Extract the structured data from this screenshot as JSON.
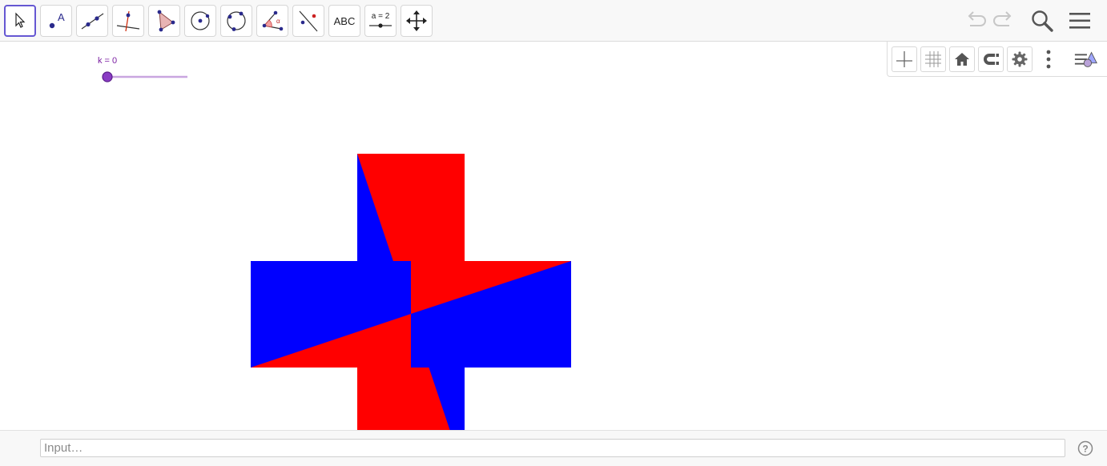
{
  "toolbar": {
    "tools": [
      {
        "name": "move-tool",
        "label": ""
      },
      {
        "name": "point-tool",
        "label": "A"
      },
      {
        "name": "line-tool",
        "label": ""
      },
      {
        "name": "perpendicular-line-tool",
        "label": ""
      },
      {
        "name": "polygon-tool",
        "label": ""
      },
      {
        "name": "circle-center-point-tool",
        "label": ""
      },
      {
        "name": "circle-three-points-tool",
        "label": ""
      },
      {
        "name": "angle-tool",
        "label": "α"
      },
      {
        "name": "reflect-tool",
        "label": ""
      },
      {
        "name": "text-tool",
        "label": "ABC"
      },
      {
        "name": "slider-tool",
        "label": "a = 2"
      },
      {
        "name": "move-graphics-view-tool",
        "label": ""
      }
    ],
    "selected_tool": "move-tool"
  },
  "slider": {
    "label": "k = 0",
    "value": 0,
    "color": "#7b1fa2"
  },
  "figure": {
    "colors": {
      "red": "#ff0000",
      "blue": "#0000ff"
    }
  },
  "input_bar": {
    "placeholder": "Input…",
    "value": ""
  },
  "icons": {
    "undo": "undo-icon",
    "redo": "redo-icon",
    "search": "search-icon",
    "menu": "menu-icon",
    "axes": "axes-icon",
    "grid": "grid-icon",
    "home": "home-icon",
    "point-capturing": "magnet-icon",
    "settings": "gear-icon",
    "more": "more-vertical-icon",
    "style-bar-toggle": "style-bar-icon",
    "help": "help-icon"
  }
}
